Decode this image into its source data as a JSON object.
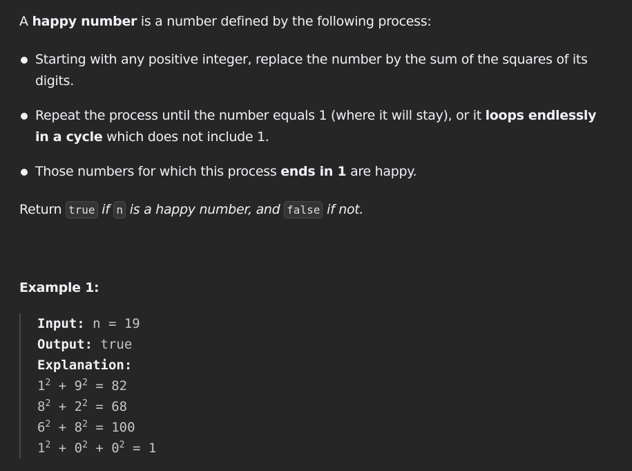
{
  "intro": {
    "prefix": "A ",
    "term": "happy number",
    "suffix": " is a number defined by the following process:"
  },
  "bullets": [
    {
      "pre": "Starting with any positive integer, replace the number by the sum of the squares of its digits.",
      "bold": "",
      "post": ""
    },
    {
      "pre": "Repeat the process until the number equals 1 (where it will stay), or it ",
      "bold": "loops endlessly in a cycle",
      "post": " which does not include 1."
    },
    {
      "pre": "Those numbers for which this process ",
      "bold": "ends in 1",
      "post": " are happy."
    }
  ],
  "return_line": {
    "word": "Return",
    "code_true": "true",
    "if_text": "if",
    "code_n": "n",
    "middle": "is a happy number, and",
    "code_false": "false",
    "end": "if not."
  },
  "example": {
    "title": "Example 1:",
    "input_label": "Input:",
    "input_value": "n = 19",
    "output_label": "Output:",
    "output_value": "true",
    "explanation_label": "Explanation:",
    "steps": [
      {
        "terms": [
          {
            "b": "1",
            "e": "2"
          },
          {
            "b": "9",
            "e": "2"
          }
        ],
        "result": "82"
      },
      {
        "terms": [
          {
            "b": "8",
            "e": "2"
          },
          {
            "b": "2",
            "e": "2"
          }
        ],
        "result": "68"
      },
      {
        "terms": [
          {
            "b": "6",
            "e": "2"
          },
          {
            "b": "8",
            "e": "2"
          }
        ],
        "result": "100"
      },
      {
        "terms": [
          {
            "b": "1",
            "e": "2"
          },
          {
            "b": "0",
            "e": "2"
          },
          {
            "b": "0",
            "e": "2"
          }
        ],
        "result": "1"
      }
    ]
  }
}
